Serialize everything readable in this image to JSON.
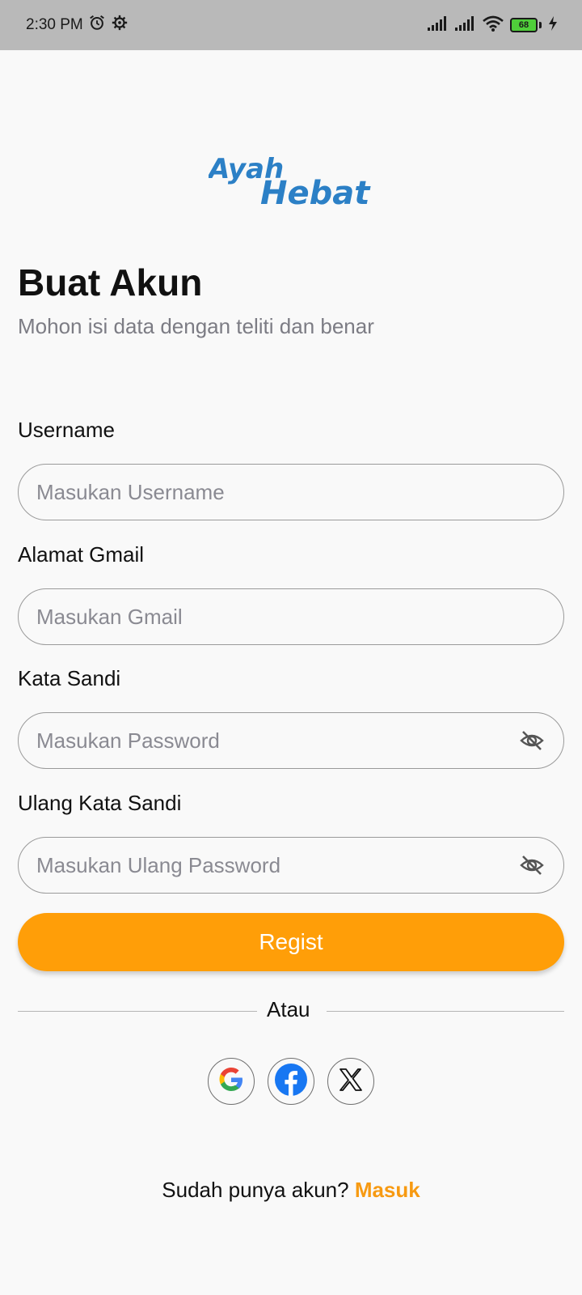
{
  "status_bar": {
    "time": "2:30 PM",
    "battery_level": "68",
    "icons": [
      "alarm-icon",
      "settings-gear-icon",
      "signal-icon",
      "signal-icon",
      "wifi-icon",
      "battery-icon",
      "charging-icon"
    ]
  },
  "logo": {
    "line1": "Ayah",
    "line2": "Hebat",
    "color": "#2c80c6"
  },
  "header": {
    "title": "Buat Akun",
    "subtitle": "Mohon isi data dengan teliti dan benar"
  },
  "form": {
    "username": {
      "label": "Username",
      "placeholder": "Masukan Username",
      "value": ""
    },
    "email": {
      "label": "Alamat Gmail",
      "placeholder": "Masukan Gmail",
      "value": ""
    },
    "password": {
      "label": "Kata Sandi",
      "placeholder": "Masukan Password",
      "value": "",
      "icon": "eye-off-icon"
    },
    "confirm_password": {
      "label": "Ulang Kata Sandi",
      "placeholder": "Masukan Ulang Password",
      "value": "",
      "icon": "eye-off-icon"
    },
    "submit_label": "Regist"
  },
  "divider": {
    "label": "Atau"
  },
  "social_login": [
    {
      "name": "google",
      "icon": "google-icon"
    },
    {
      "name": "facebook",
      "icon": "facebook-icon"
    },
    {
      "name": "x",
      "icon": "x-icon"
    }
  ],
  "footer": {
    "prompt": "Sudah punya akun?",
    "link_label": "Masuk"
  },
  "colors": {
    "accent": "#ff9e08",
    "link": "#f79a12",
    "background": "#f9f9f9",
    "status_bar": "#b9b9b9"
  }
}
